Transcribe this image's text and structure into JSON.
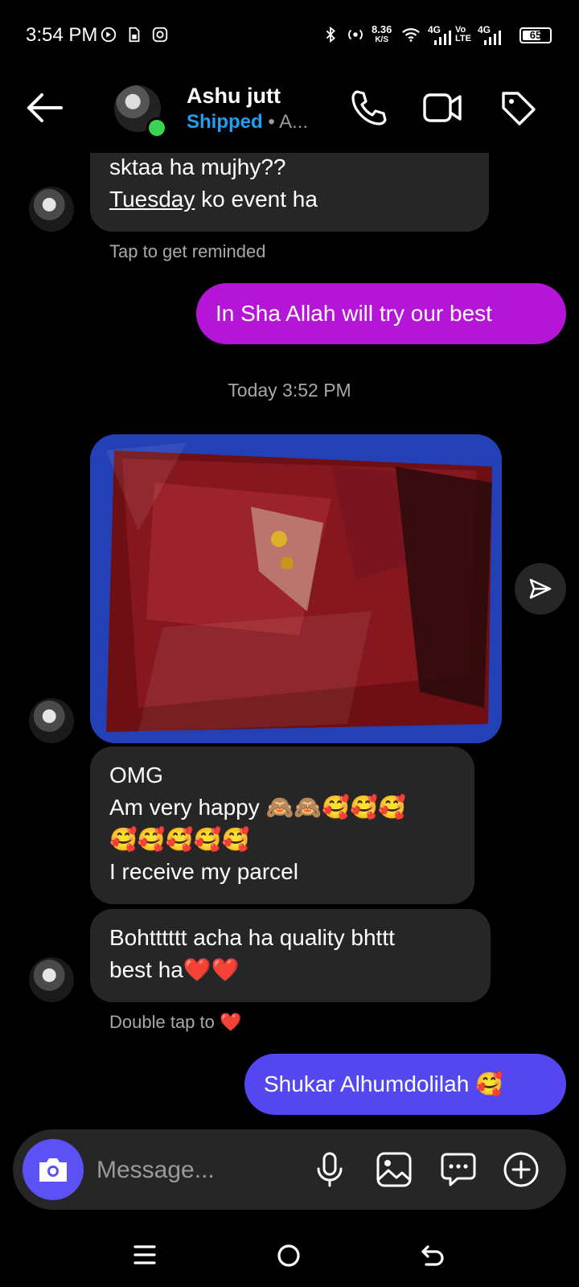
{
  "status_bar": {
    "time": "3:54 PM",
    "net_speed": "8.36",
    "net_unit": "K/S",
    "sim1": "4G",
    "volte": "Vo LTE",
    "sim2": "4G",
    "battery": "65"
  },
  "header": {
    "name": "Ashu jutt",
    "status_label": "Shipped",
    "status_rest": " • A..."
  },
  "thread": {
    "msg1": {
      "line1": "sktaa ha mujhy??",
      "link_word": "Tuesday",
      "line2_rest": " ko event ha"
    },
    "reminder": "Tap to get reminded",
    "out1": "In Sha Allah will try our best",
    "timestamp": "Today 3:52 PM",
    "msg2": {
      "line1": "OMG",
      "line2": "Am very happy 🙈🙈🥰🥰🥰",
      "line3": "🥰🥰🥰🥰🥰",
      "line4": "I receive my parcel"
    },
    "msg3": {
      "line1": "Bohtttttt acha ha quality bhttt",
      "line2": "best ha❤️❤️"
    },
    "double_tap": "Double tap to ❤️",
    "out2": "Shukar Alhumdolilah 🥰"
  },
  "composer": {
    "placeholder": "Message..."
  },
  "colors": {
    "accent_purple": "#5b51f5",
    "bubble_magenta": "#b415d6",
    "bubble_indigo": "#5447f0",
    "incoming_bubble": "#262626",
    "shipped_blue": "#1ea1f2"
  }
}
